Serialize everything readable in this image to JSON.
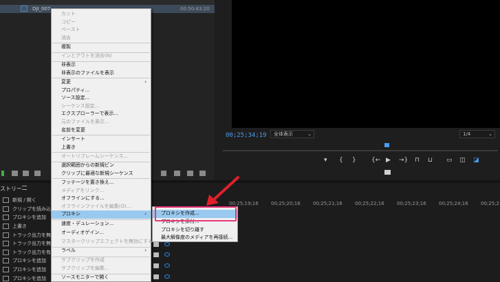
{
  "project_panel": {
    "clip_name": "DJI_007",
    "clip_duration": "00:50:43:20"
  },
  "program_monitor": {
    "timecode": "00;25;34;19",
    "fit_select": "全体表示",
    "quality_select": "1/4",
    "transport_icons": [
      "marker-icon",
      "in-point-icon",
      "out-point-icon",
      "go-to-in-icon",
      "play-icon",
      "go-to-out-icon",
      "lift-icon",
      "extract-icon",
      "safe-margins-icon",
      "comparison-icon",
      "multicam-icon",
      "export-frame-icon"
    ]
  },
  "history_panel": {
    "tab_label": "ストリー",
    "items": [
      "新規 / 開く",
      "クリップを読み込む",
      "プロキシを追加",
      "上書き",
      "トラック出力を無効",
      "トラック出力を無効",
      "トラック出力を有効",
      "プロキシを追加",
      "プロキシを追加",
      "プロキシを追加"
    ]
  },
  "timeline": {
    "timecodes": [
      "00;25;19;16",
      "00;25;20;16",
      "00;25;21;16",
      "00;25;22;16",
      "00;25;23;16",
      "00;25;24;16",
      "00;25;2"
    ]
  },
  "context_menu": {
    "items": [
      {
        "label": "カット",
        "disabled": true
      },
      {
        "label": "コピー",
        "disabled": true
      },
      {
        "label": "ペースト",
        "disabled": true
      },
      {
        "label": "消去",
        "disabled": true
      },
      {
        "label": "複製",
        "disabled": false
      },
      {
        "label": "インとアウトを消去(N)",
        "disabled": true
      },
      {
        "label": "非表示",
        "disabled": false
      },
      {
        "label": "非表示のファイルを表示",
        "disabled": false
      },
      {
        "label": "変更",
        "disabled": false,
        "submenu": true
      },
      {
        "label": "プロパティ...",
        "disabled": false
      },
      {
        "label": "ソース設定...",
        "disabled": false
      },
      {
        "label": "シーケンス設定...",
        "disabled": true
      },
      {
        "label": "エクスプローラーで表示...",
        "disabled": false
      },
      {
        "label": "元のファイルを表示...",
        "disabled": true
      },
      {
        "label": "名前を変更",
        "disabled": false
      },
      {
        "label": "インサート",
        "disabled": false
      },
      {
        "label": "上書き",
        "disabled": false
      },
      {
        "label": "オートリフレームシーケンス...",
        "disabled": true
      },
      {
        "label": "選択範囲からの新規ビン",
        "disabled": false
      },
      {
        "label": "クリップに最適な新規シーケンス",
        "disabled": false
      },
      {
        "label": "フッテージを置き換え...",
        "disabled": false
      },
      {
        "label": "メディアをリンク...",
        "disabled": true
      },
      {
        "label": "オフラインにする...",
        "disabled": false
      },
      {
        "label": "オフラインファイルを編集(O)...",
        "disabled": true
      },
      {
        "label": "プロキシ",
        "disabled": false,
        "submenu": true,
        "active": true
      },
      {
        "label": "速度・デュレーション...",
        "disabled": false
      },
      {
        "label": "オーディオゲイン...",
        "disabled": false
      },
      {
        "label": "マスタークリップエフェクトを無効にする",
        "disabled": true
      },
      {
        "label": "ラベル",
        "disabled": false,
        "submenu": true
      },
      {
        "label": "サブクリップを作成",
        "disabled": true
      },
      {
        "label": "サブクリップを編集...",
        "disabled": true
      },
      {
        "label": "ソースモニターで開く",
        "disabled": false
      }
    ]
  },
  "proxy_submenu": {
    "items": [
      "プロキシを作成...",
      "プロキシを添付...",
      "プロキシを切り離す",
      "最大解像度のメディアを再接続..."
    ]
  },
  "colors": {
    "accent_blue": "#4c9cf0",
    "menu_highlight": "#99c9ef",
    "callout_pink": "#e8357a",
    "arrow_red": "#e0202a"
  }
}
